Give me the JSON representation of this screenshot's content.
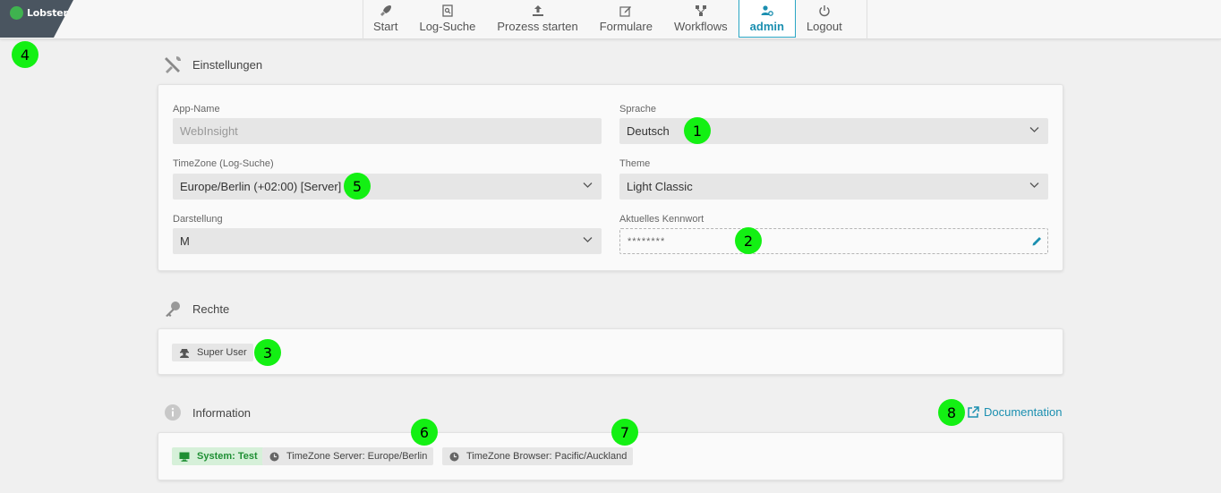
{
  "logo": {
    "text": "Lobster"
  },
  "nav": {
    "items": [
      {
        "label": "Start",
        "icon": "rocket-icon"
      },
      {
        "label": "Log-Suche",
        "icon": "document-search-icon"
      },
      {
        "label": "Prozess starten",
        "icon": "upload-icon"
      },
      {
        "label": "Formulare",
        "icon": "edit-form-icon"
      },
      {
        "label": "Workflows",
        "icon": "workflow-icon"
      },
      {
        "label": "admin",
        "icon": "user-gear-icon",
        "active": true
      },
      {
        "label": "Logout",
        "icon": "power-icon"
      }
    ]
  },
  "settings": {
    "title": "Einstellungen",
    "app_name": {
      "label": "App-Name",
      "value": "WebInsight"
    },
    "language": {
      "label": "Sprache",
      "value": "Deutsch"
    },
    "timezone": {
      "label": "TimeZone (Log-Suche)",
      "value": "Europe/Berlin (+02:00) [Server]"
    },
    "theme": {
      "label": "Theme",
      "value": "Light Classic"
    },
    "display": {
      "label": "Darstellung",
      "value": "M"
    },
    "password": {
      "label": "Aktuelles Kennwort",
      "value": "********"
    }
  },
  "rights": {
    "title": "Rechte",
    "tags": [
      {
        "label": "Super User"
      }
    ]
  },
  "information": {
    "title": "Information",
    "doc_link": "Documentation",
    "tags": [
      {
        "label": "System: Test"
      },
      {
        "label": "TimeZone Server: Europe/Berlin"
      },
      {
        "label": "TimeZone Browser: Pacific/Auckland"
      }
    ]
  },
  "markers": [
    "1",
    "2",
    "3",
    "4",
    "5",
    "6",
    "7",
    "8"
  ],
  "colors": {
    "accent": "#1b8fb0",
    "marker": "#13f013",
    "system_tag": "#1f8f34"
  }
}
